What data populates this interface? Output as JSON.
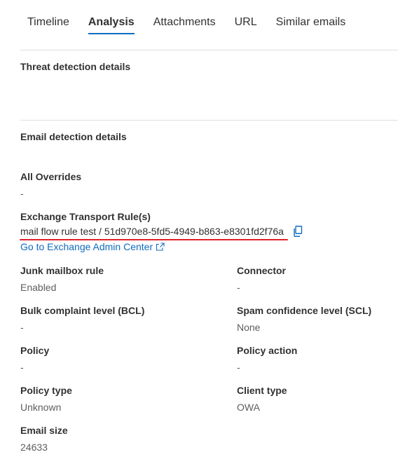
{
  "tabs": [
    {
      "label": "Timeline"
    },
    {
      "label": "Analysis"
    },
    {
      "label": "Attachments"
    },
    {
      "label": "URL"
    },
    {
      "label": "Similar emails"
    }
  ],
  "active_tab": "Analysis",
  "threat_section": {
    "title": "Threat detection details"
  },
  "email_section": {
    "title": "Email detection details"
  },
  "all_overrides": {
    "label": "All Overrides",
    "value": "-"
  },
  "transport_rule": {
    "label": "Exchange Transport Rule(s)",
    "value": "mail flow rule test / 51d970e8-5fd5-4949-b863-e8301fd2f76a",
    "link_text": "Go to Exchange Admin Center"
  },
  "fields": {
    "junk_mailbox_rule": {
      "label": "Junk mailbox rule",
      "value": "Enabled"
    },
    "connector": {
      "label": "Connector",
      "value": "-"
    },
    "bcl": {
      "label": "Bulk complaint level (BCL)",
      "value": "-"
    },
    "scl": {
      "label": "Spam confidence level (SCL)",
      "value": "None"
    },
    "policy": {
      "label": "Policy",
      "value": "-"
    },
    "policy_action": {
      "label": "Policy action",
      "value": "-"
    },
    "policy_type": {
      "label": "Policy type",
      "value": "Unknown"
    },
    "client_type": {
      "label": "Client type",
      "value": "OWA"
    },
    "email_size": {
      "label": "Email size",
      "value": "24633"
    }
  },
  "colors": {
    "accent": "#0f6cbd",
    "annotation_underline": "#e0212b",
    "divider": "#e1dfdd"
  },
  "icons": {
    "copy": "copy-icon",
    "external_link": "external-link-icon"
  }
}
